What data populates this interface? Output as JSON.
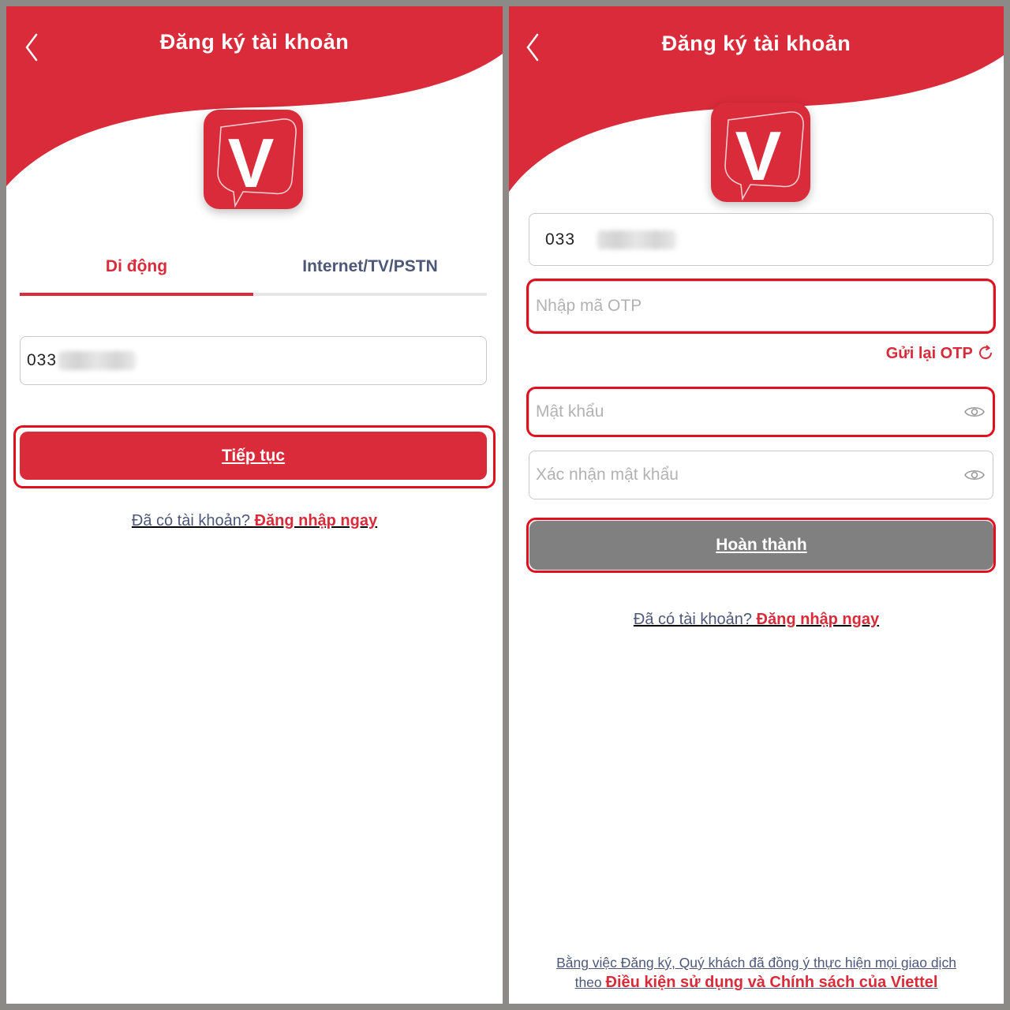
{
  "colors": {
    "brand_red": "#d92b3a",
    "disabled_gray": "#808080",
    "muted_text": "#4d5878",
    "highlight": "#e0101f"
  },
  "left_screen": {
    "header": {
      "title": "Đăng ký tài khoản",
      "back_icon": "chevron-left-icon"
    },
    "logo_letter": "V",
    "tabs": [
      {
        "label": "Di động",
        "active": true
      },
      {
        "label": "Internet/TV/PSTN",
        "active": false
      }
    ],
    "phone_input": {
      "value": "033"
    },
    "continue_button": "Tiếp tục",
    "login_prompt": {
      "question": "Đã có tài khoản?",
      "action": "Đăng nhập ngay"
    }
  },
  "right_screen": {
    "header": {
      "title": "Đăng ký tài khoản",
      "back_icon": "chevron-left-icon"
    },
    "logo_letter": "V",
    "phone_input": {
      "value": "033"
    },
    "otp_input": {
      "placeholder": "Nhập mã OTP"
    },
    "resend_otp": {
      "label": "Gửi lại OTP",
      "icon": "refresh-icon"
    },
    "password_input": {
      "placeholder": "Mật khẩu",
      "icon": "eye-icon"
    },
    "confirm_password_input": {
      "placeholder": "Xác nhận mật khẩu",
      "icon": "eye-icon"
    },
    "complete_button": "Hoàn thành",
    "login_prompt": {
      "question": "Đã có tài khoản?",
      "action": "Đăng nhập ngay"
    },
    "terms": {
      "line1": "Bằng việc Đăng ký, Quý khách đã đồng ý thực hiện mọi giao dịch",
      "prefix": "theo",
      "link": "Điều kiện sử dụng và Chính sách của Viettel"
    }
  }
}
